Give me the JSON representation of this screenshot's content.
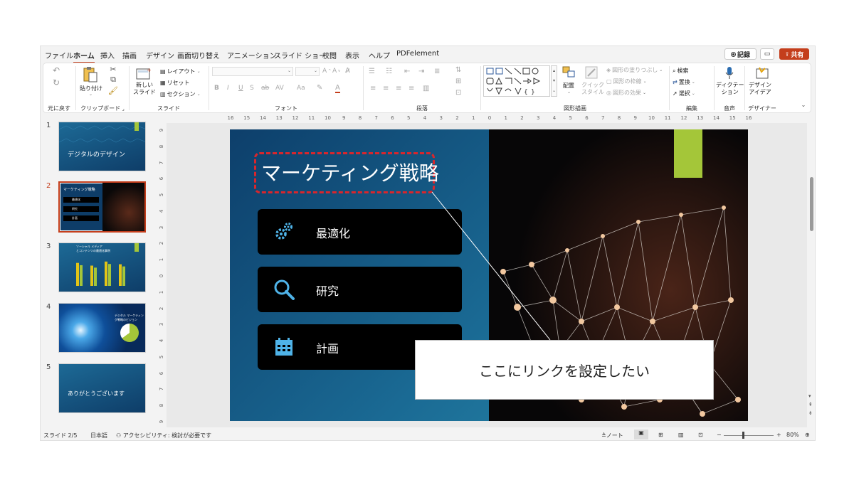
{
  "tabs": [
    {
      "label": "ファイル",
      "active": false
    },
    {
      "label": "ホーム",
      "active": true
    },
    {
      "label": "挿入",
      "active": false
    },
    {
      "label": "描画",
      "active": false
    },
    {
      "label": "デザイン",
      "active": false
    },
    {
      "label": "画面切り替え",
      "active": false
    },
    {
      "label": "アニメーション",
      "active": false
    },
    {
      "label": "スライド ショー",
      "active": false
    },
    {
      "label": "校閲",
      "active": false
    },
    {
      "label": "表示",
      "active": false
    },
    {
      "label": "ヘルプ",
      "active": false
    },
    {
      "label": "PDFelement",
      "active": false
    }
  ],
  "top_buttons": {
    "record": "記録",
    "share": "共有"
  },
  "ribbon": {
    "undo": {
      "label": "元に戻す"
    },
    "clipboard": {
      "paste": "貼り付け",
      "label": "クリップボード"
    },
    "slides": {
      "new_slide": "新しい\nスライド",
      "layout": "レイアウト",
      "reset": "リセット",
      "section": "セクション",
      "label": "スライド"
    },
    "font": {
      "label": "フォント"
    },
    "paragraph": {
      "label": "段落"
    },
    "drawing": {
      "arrange": "配置",
      "quick_style": "クイック\nスタイル",
      "fill": "図形の塗りつぶし",
      "outline": "図形の枠線",
      "effects": "図形の効果",
      "label": "図形描画"
    },
    "editing": {
      "find": "検索",
      "replace": "置換",
      "select": "選択",
      "label": "編集"
    },
    "voice": {
      "dictate": "ディクテー\nション",
      "label": "音声"
    },
    "designer": {
      "ideas": "デザイン\nアイデア",
      "label": "デザイナー"
    }
  },
  "hruler": {
    "labels": [
      "16",
      "15",
      "14",
      "13",
      "12",
      "11",
      "10",
      "9",
      "8",
      "7",
      "6",
      "5",
      "4",
      "3",
      "2",
      "1",
      "0",
      "1",
      "2",
      "3",
      "4",
      "5",
      "6",
      "7",
      "8",
      "9",
      "10",
      "11",
      "12",
      "13",
      "14",
      "15",
      "16"
    ]
  },
  "vruler": {
    "labels": [
      "9",
      "8",
      "7",
      "6",
      "5",
      "4",
      "3",
      "2",
      "1",
      "0",
      "1",
      "2",
      "3",
      "4",
      "5",
      "6",
      "7",
      "8",
      "9"
    ]
  },
  "thumbnails": [
    {
      "num": "1",
      "title": "デジタルのデザイン",
      "selected": false
    },
    {
      "num": "2",
      "title": "マーケティング戦略",
      "items": [
        "最適化",
        "研究",
        "計画"
      ],
      "selected": true
    },
    {
      "num": "3",
      "title": "ソーシャル メディア\nとコンテンツの最適化事例",
      "bars": [
        0.85,
        0.75,
        0.9,
        0.8
      ],
      "selected": false
    },
    {
      "num": "4",
      "title": "デジタル マーケティン\nグ戦略のビジョン",
      "selected": false
    },
    {
      "num": "5",
      "title": "ありがとうございます",
      "selected": false
    }
  ],
  "slide": {
    "title": "マーケティング戦略",
    "items": [
      {
        "label": "最適化",
        "icon": "gears-icon"
      },
      {
        "label": "研究",
        "icon": "magnifier-icon"
      },
      {
        "label": "計画",
        "icon": "calendar-icon"
      }
    ],
    "callout": "ここにリンクを設定したい"
  },
  "status": {
    "slide": "スライド 2/5",
    "language": "日本語",
    "accessibility": "アクセシビリティ: 検討が必要です",
    "notes": "ノート",
    "zoom": "80%"
  },
  "colors": {
    "accent": "#c43e1c",
    "lime": "#a4c639",
    "callout_border": "#d9262c"
  }
}
